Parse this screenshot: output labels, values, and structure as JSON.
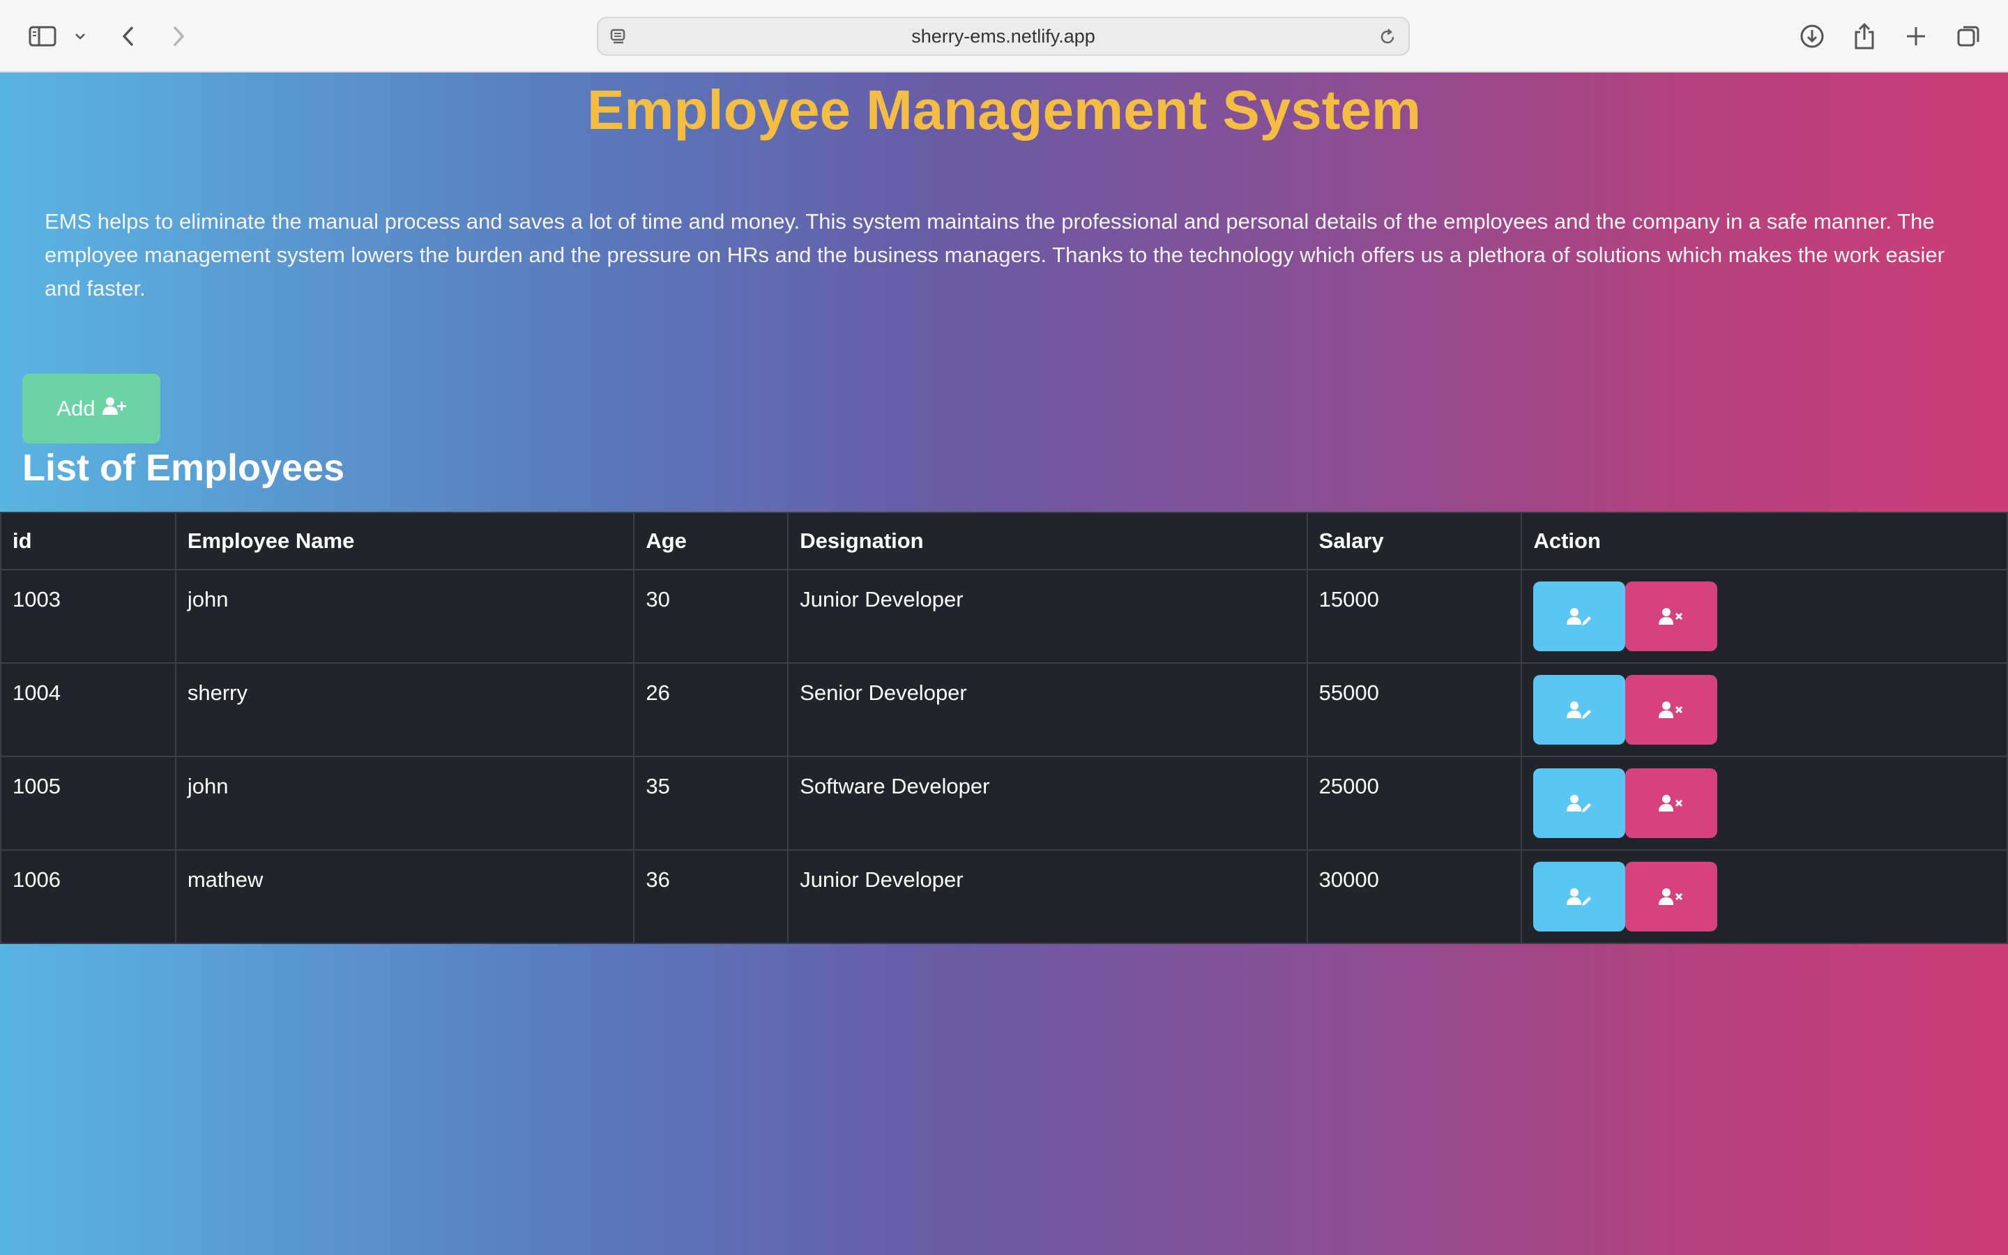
{
  "browser": {
    "url": "sherry-ems.netlify.app"
  },
  "page": {
    "title": "Employee Management System",
    "description": "EMS helps to eliminate the manual process and saves a lot of time and money. This system maintains the professional and personal details of the employees and the company in a safe manner. The employee management system lowers the burden and the pressure on HRs and the business managers. Thanks to the technology which offers us a plethora of solutions which makes the work easier and faster.",
    "add_button_label": "Add",
    "add_button_icon": "user-plus-icon",
    "list_title": "List of Employees"
  },
  "table": {
    "headers": [
      "id",
      "Employee Name",
      "Age",
      "Designation",
      "Salary",
      "Action"
    ],
    "rows": [
      {
        "id": "1003",
        "name": "john",
        "age": "30",
        "designation": "Junior Developer",
        "salary": "15000"
      },
      {
        "id": "1004",
        "name": "sherry",
        "age": "26",
        "designation": "Senior Developer",
        "salary": "55000"
      },
      {
        "id": "1005",
        "name": "john",
        "age": "35",
        "designation": "Software Developer",
        "salary": "25000"
      },
      {
        "id": "1006",
        "name": "mathew",
        "age": "36",
        "designation": "Junior Developer",
        "salary": "30000"
      }
    ],
    "edit_icon": "user-edit-icon",
    "delete_icon": "user-remove-icon"
  },
  "colors": {
    "title": "#f4bd44",
    "add_button": "#6bd3a6",
    "edit_button": "#5cc6f2",
    "delete_button": "#d6427e",
    "table_bg": "#212529"
  }
}
